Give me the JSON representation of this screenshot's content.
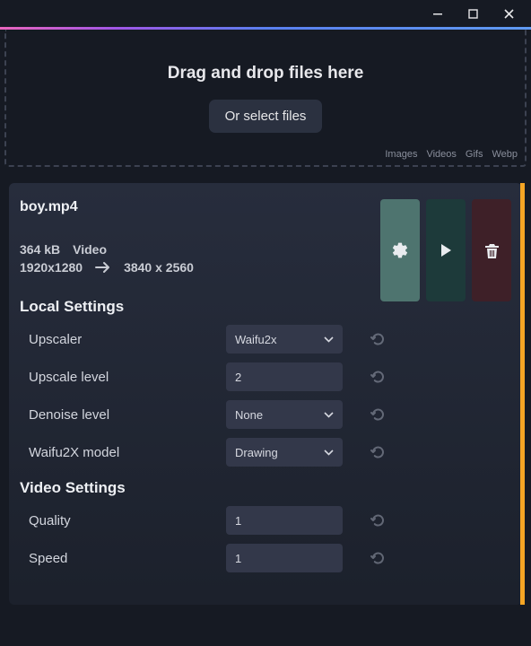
{
  "dropzone": {
    "title": "Drag and drop files here",
    "select_button": "Or select files",
    "types": [
      "Images",
      "Videos",
      "Gifs",
      "Webp"
    ]
  },
  "file": {
    "name": "boy.mp4",
    "size": "364 kB",
    "kind": "Video",
    "src_dims": "1920x1280",
    "dst_dims": "3840 x 2560"
  },
  "sections": {
    "local": "Local Settings",
    "video": "Video Settings"
  },
  "settings": {
    "upscaler": {
      "label": "Upscaler",
      "value": "Waifu2x"
    },
    "upscale_level": {
      "label": "Upscale level",
      "value": "2"
    },
    "denoise_level": {
      "label": "Denoise level",
      "value": "None"
    },
    "waifu2x_model": {
      "label": "Waifu2X model",
      "value": "Drawing"
    },
    "quality": {
      "label": "Quality",
      "value": "1"
    },
    "speed": {
      "label": "Speed",
      "value": "1"
    }
  }
}
